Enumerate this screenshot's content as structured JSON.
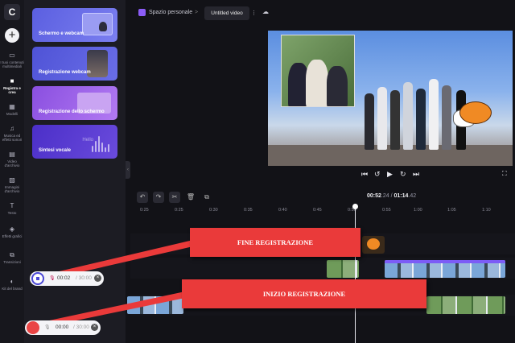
{
  "app": {
    "logo_letter": "C"
  },
  "rail": {
    "items": [
      {
        "label": "I tuoi contenuti multimediali",
        "icon": "folder-icon",
        "glyph": "▭"
      },
      {
        "label": "Registra e crea",
        "icon": "camera-icon",
        "glyph": "■"
      },
      {
        "label": "Modelli",
        "icon": "templates-icon",
        "glyph": "▦"
      },
      {
        "label": "Musica ed effetti sonori",
        "icon": "music-icon",
        "glyph": "♫"
      },
      {
        "label": "Video d'archivio",
        "icon": "film-icon",
        "glyph": "▤"
      },
      {
        "label": "Immagini d'archivio",
        "icon": "image-icon",
        "glyph": "▨"
      },
      {
        "label": "Testo",
        "icon": "text-icon",
        "glyph": "T"
      },
      {
        "label": "Effetti grafici",
        "icon": "shapes-icon",
        "glyph": "◈"
      },
      {
        "label": "Transizioni",
        "icon": "transitions-icon",
        "glyph": "⧉"
      },
      {
        "label": "Kit del brand",
        "icon": "brand-icon",
        "glyph": "◐"
      }
    ]
  },
  "panel": {
    "cards": [
      {
        "label": "Schermo e webcam"
      },
      {
        "label": "Registrazione webcam"
      },
      {
        "label": "Registrazione dello schermo"
      },
      {
        "label": "Sintesi vocale",
        "decoration": "Hello"
      }
    ]
  },
  "topbar": {
    "workspace": "Spazio personale",
    "separator": ">",
    "title": "Untitled video",
    "menu_glyph": "⋮"
  },
  "player": {
    "controls": [
      "⏮",
      "↺",
      "▶",
      "↻",
      "⏭"
    ],
    "fullscreen_glyph": "⛶"
  },
  "timeline": {
    "current_time": "00:52",
    "current_frac": ".24",
    "separator": "/",
    "total_time": "01:14",
    "total_frac": ".42",
    "tools": [
      "↶",
      "↷",
      "✂",
      "🗑",
      "⧉"
    ],
    "ticks": [
      "0:25",
      "0:25",
      "0:30",
      "0:35",
      "0:40",
      "0:45",
      "0:50",
      "0:55",
      "1:00",
      "1:05",
      "1:10"
    ]
  },
  "callouts": {
    "end": "FINE REGISTRAZIONE",
    "start": "INIZIO REGISTRAZIONE"
  },
  "recorders": {
    "stop": {
      "elapsed": "00:02",
      "limit": "/ 30:00"
    },
    "start": {
      "elapsed": "00:00",
      "limit": "/ 30:00"
    }
  },
  "colors": {
    "accent": "#7c5cf6",
    "callout": "#ea3a3a",
    "record": "#ea4545",
    "stop": "#4a47d6"
  }
}
